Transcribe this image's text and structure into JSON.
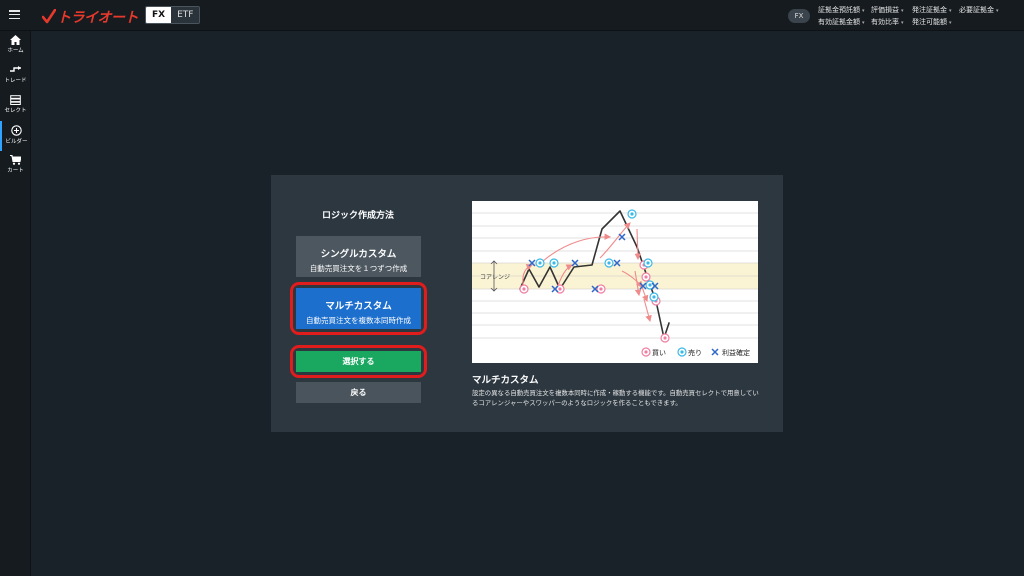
{
  "header": {
    "logo_text": "トライオート",
    "tabs": [
      {
        "label": "FX",
        "selected": true
      },
      {
        "label": "ETF",
        "selected": false
      }
    ],
    "market_badge": "FX",
    "account_metrics": [
      "証拠金預託額",
      "評価損益",
      "発注証拠金",
      "必要証拠金",
      "有効証拠金額",
      "有効比率",
      "発注可能額"
    ]
  },
  "sidebar": {
    "items": [
      {
        "label": "ホーム",
        "icon": "home-icon"
      },
      {
        "label": "トレード",
        "icon": "trade-icon"
      },
      {
        "label": "セレクト",
        "icon": "select-icon"
      },
      {
        "label": "ビルダー",
        "icon": "builder-icon",
        "active": true
      },
      {
        "label": "カート",
        "icon": "cart-icon"
      }
    ]
  },
  "dialog": {
    "title": "ロジック作成方法",
    "options": {
      "single": {
        "title": "シングルカスタム",
        "subtitle": "自動売買注文を１つずつ作成"
      },
      "multi": {
        "title": "マルチカスタム",
        "subtitle": "自動売買注文を複数本同時作成",
        "selected": true
      }
    },
    "select_button": "選択する",
    "back_button": "戻る",
    "diagram": {
      "band_label": "コアレンジ",
      "legend": {
        "buy": "買い",
        "sell": "売り",
        "settle": "利益確定"
      }
    },
    "description_title": "マルチカスタム",
    "description": "設定の異なる自動売買注文を複数本同時に作成・稼動する機能です。自動売買セレクトで用意しているコアレンジャーやスワッパーのようなロジックを作ることもできます。"
  },
  "colors": {
    "accent_red": "#e7392b",
    "selected_blue": "#1d6fce",
    "select_green": "#1aa861",
    "highlight_ring": "#e01c1c",
    "buy_pink": "#f17ea1",
    "sell_cyan": "#3bb8e8",
    "settle_blue": "#2f68c8"
  }
}
